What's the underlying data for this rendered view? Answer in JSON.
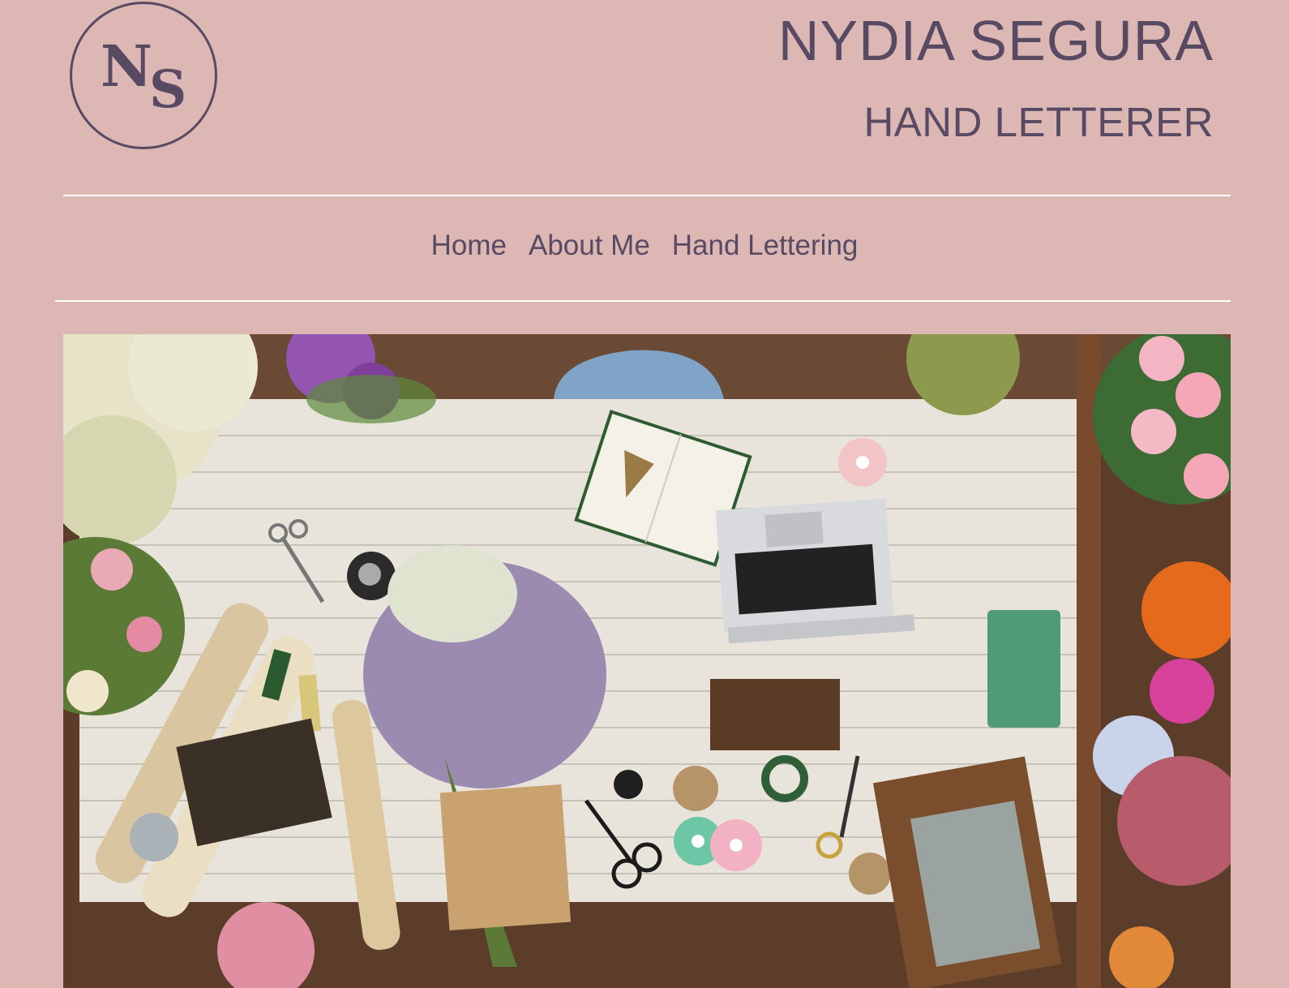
{
  "logo": {
    "letter_1": "N",
    "letter_2": "S"
  },
  "header": {
    "title": "NYDIA SEGURA",
    "subtitle": "HAND LETTERER"
  },
  "nav": {
    "items": [
      {
        "label": "Home"
      },
      {
        "label": "About Me"
      },
      {
        "label": "Hand Lettering"
      }
    ]
  },
  "colors": {
    "background": "#ddb7b3",
    "text": "#584a63",
    "divider": "#ffffff"
  },
  "hero": {
    "description_icon": "florist-workspace-image"
  }
}
